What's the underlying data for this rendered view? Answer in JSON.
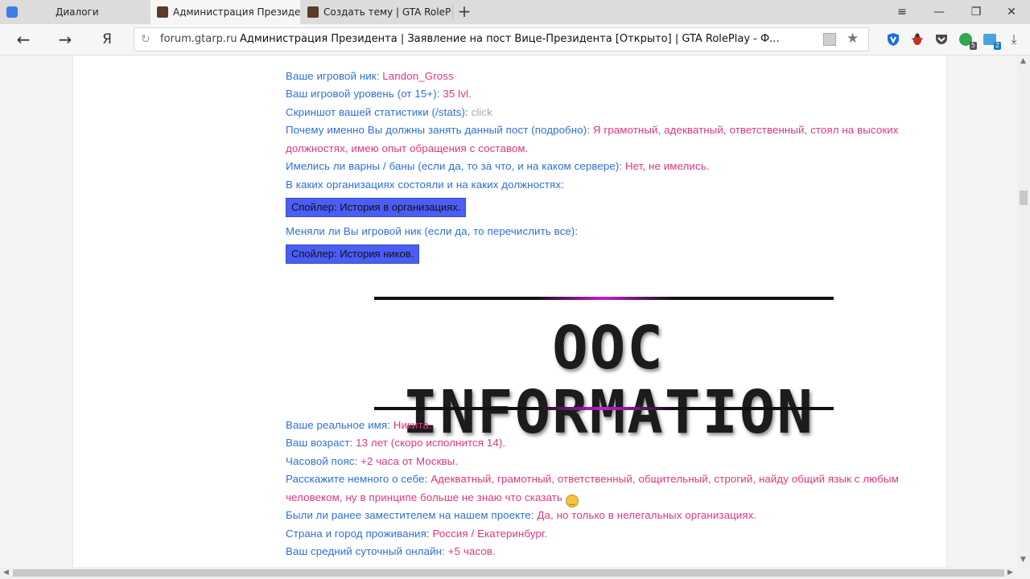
{
  "tabs": [
    {
      "label": "Диалоги",
      "active": false
    },
    {
      "label": "Администрация Президе",
      "active": true
    },
    {
      "label": "Создать тему | GTA RolePlay",
      "active": false
    }
  ],
  "address": {
    "domain": "forum.gtarp.ru",
    "title": "Администрация Президента | Заявление на пост Вице-Президента [Открыто] | GTA RolePlay - Ф..."
  },
  "extensions": [
    {
      "name": "shield-icon",
      "badge": ""
    },
    {
      "name": "bug-icon",
      "badge": ""
    },
    {
      "name": "pocket-icon",
      "badge": ""
    },
    {
      "name": "chat-icon",
      "badge": "5"
    },
    {
      "name": "translate-icon",
      "badge": "2"
    }
  ],
  "ic": [
    {
      "q": "Ваше игровой ник: ",
      "a": "Landon_Gross"
    },
    {
      "q": "Ваш игровой уровень (от 15+): ",
      "a": "35 lvl."
    },
    {
      "q": "Скриншот вашей статистики (/stats): ",
      "a": "click"
    },
    {
      "q": "Почему именно Вы должны занять данный пост (подробно): ",
      "a": "Я грамотный, адекватный, ответственный, стоял на высоких"
    },
    {
      "q": "",
      "a": "должностях, имею опыт обращения с составом."
    },
    {
      "q": "Имелись ли варны / баны (если да, то за что, и на каком сервере): ",
      "a": "Нет, не имелись."
    },
    {
      "q": "В каких организациях состояли и на каких должностях:",
      "a": ""
    }
  ],
  "spoiler1": "Спойлер: История в организациях.",
  "nick_question": "Меняли ли Вы игровой ник (если да, то перечислить все):",
  "spoiler2": "Спойлер: История ников.",
  "ooc_banner": "OOC INFORMATION",
  "ooc": [
    {
      "q": "Ваше реальное имя: ",
      "a": "Никита."
    },
    {
      "q": "Ваш возраст: ",
      "a": "13 лет (скоро исполнится 14)."
    },
    {
      "q": "Часовой пояс: ",
      "a": "+2 часа от Москвы."
    },
    {
      "q": "Расскажите немного о себе: ",
      "a": "Адекватный, грамотный, ответственный, общительный, строгий, найду общий язык с любым"
    },
    {
      "q": "",
      "a": "человеком, ну в принципе больше не знаю что сказать"
    },
    {
      "q": "Были ли ранее заместителем на нашем проекте: ",
      "a": "Да, но только в нелегальных организациях."
    },
    {
      "q": "Страна и город проживания: ",
      "a": "Россия / Екатеринбург."
    },
    {
      "q": "Ваш средний суточный онлайн: ",
      "a": "+5 часов."
    }
  ]
}
